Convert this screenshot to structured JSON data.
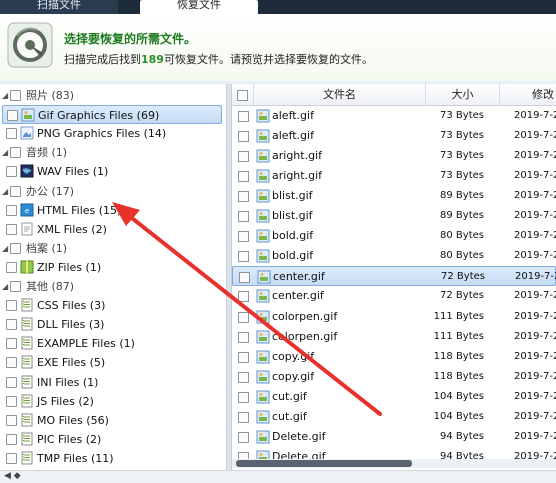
{
  "tabs": [
    {
      "label": "扫描文件"
    },
    {
      "label": "恢复文件"
    }
  ],
  "banner": {
    "title": "选择要恢复的所需文件。",
    "sub_prefix": "扫描完成后找到",
    "count": "189",
    "sub_suffix": "可恢复文件。请预览并选择要恢复的文件。"
  },
  "tree": [
    {
      "label": "照片 (83)",
      "kind": "category",
      "icon": "caret-icon"
    },
    {
      "label": "Gif Graphics Files (69)",
      "kind": "item",
      "icon": "gif-file-icon",
      "selected": true
    },
    {
      "label": "PNG Graphics Files (14)",
      "kind": "item",
      "icon": "png-file-icon"
    },
    {
      "label": "音频 (1)",
      "kind": "category",
      "icon": "caret-icon"
    },
    {
      "label": "WAV Files (1)",
      "kind": "item",
      "icon": "wav-file-icon"
    },
    {
      "label": "办公 (17)",
      "kind": "category",
      "icon": "caret-icon"
    },
    {
      "label": "HTML Files (15)",
      "kind": "item",
      "icon": "html-file-icon"
    },
    {
      "label": "XML Files (2)",
      "kind": "item",
      "icon": "xml-file-icon"
    },
    {
      "label": "档案 (1)",
      "kind": "category",
      "icon": "caret-icon"
    },
    {
      "label": "ZIP Files (1)",
      "kind": "item",
      "icon": "zip-file-icon"
    },
    {
      "label": "其他 (87)",
      "kind": "category",
      "icon": "caret-icon"
    },
    {
      "label": "CSS Files (3)",
      "kind": "item",
      "icon": "generic-file-icon"
    },
    {
      "label": "DLL Files (3)",
      "kind": "item",
      "icon": "generic-file-icon"
    },
    {
      "label": "EXAMPLE Files (1)",
      "kind": "item",
      "icon": "generic-file-icon"
    },
    {
      "label": "EXE Files (5)",
      "kind": "item",
      "icon": "generic-file-icon"
    },
    {
      "label": "INI Files (1)",
      "kind": "item",
      "icon": "generic-file-icon"
    },
    {
      "label": "JS Files (2)",
      "kind": "item",
      "icon": "generic-file-icon"
    },
    {
      "label": "MO Files (56)",
      "kind": "item",
      "icon": "generic-file-icon"
    },
    {
      "label": "PIC Files (2)",
      "kind": "item",
      "icon": "generic-file-icon"
    },
    {
      "label": "TMP Files (11)",
      "kind": "item",
      "icon": "generic-file-icon"
    }
  ],
  "list": {
    "columns": {
      "name": "文件名",
      "size": "大小",
      "date": "修改"
    },
    "rows": [
      {
        "name": "aleft.gif",
        "size": "73 Bytes",
        "date": "2019-7-2"
      },
      {
        "name": "aleft.gif",
        "size": "73 Bytes",
        "date": "2019-7-2"
      },
      {
        "name": "aright.gif",
        "size": "73 Bytes",
        "date": "2019-7-2"
      },
      {
        "name": "aright.gif",
        "size": "73 Bytes",
        "date": "2019-7-2"
      },
      {
        "name": "blist.gif",
        "size": "89 Bytes",
        "date": "2019-7-2"
      },
      {
        "name": "blist.gif",
        "size": "89 Bytes",
        "date": "2019-7-2"
      },
      {
        "name": "bold.gif",
        "size": "80 Bytes",
        "date": "2019-7-2"
      },
      {
        "name": "bold.gif",
        "size": "80 Bytes",
        "date": "2019-7-2"
      },
      {
        "name": "center.gif",
        "size": "72 Bytes",
        "date": "2019-7-2",
        "selected": true
      },
      {
        "name": "center.gif",
        "size": "72 Bytes",
        "date": "2019-7-2"
      },
      {
        "name": "colorpen.gif",
        "size": "111 Bytes",
        "date": "2019-7-2"
      },
      {
        "name": "colorpen.gif",
        "size": "111 Bytes",
        "date": "2019-7-2"
      },
      {
        "name": "copy.gif",
        "size": "118 Bytes",
        "date": "2019-7-2"
      },
      {
        "name": "copy.gif",
        "size": "118 Bytes",
        "date": "2019-7-2"
      },
      {
        "name": "cut.gif",
        "size": "104 Bytes",
        "date": "2019-7-2"
      },
      {
        "name": "cut.gif",
        "size": "104 Bytes",
        "date": "2019-7-2"
      },
      {
        "name": "Delete.gif",
        "size": "94 Bytes",
        "date": "2019-7-2"
      },
      {
        "name": "Delete.gif",
        "size": "94 Bytes",
        "date": "2019-7-2"
      }
    ]
  },
  "colors": {
    "accent_green": "#1f7a1f",
    "selection": "#c5dcf5",
    "arrow": "#e8312a"
  }
}
